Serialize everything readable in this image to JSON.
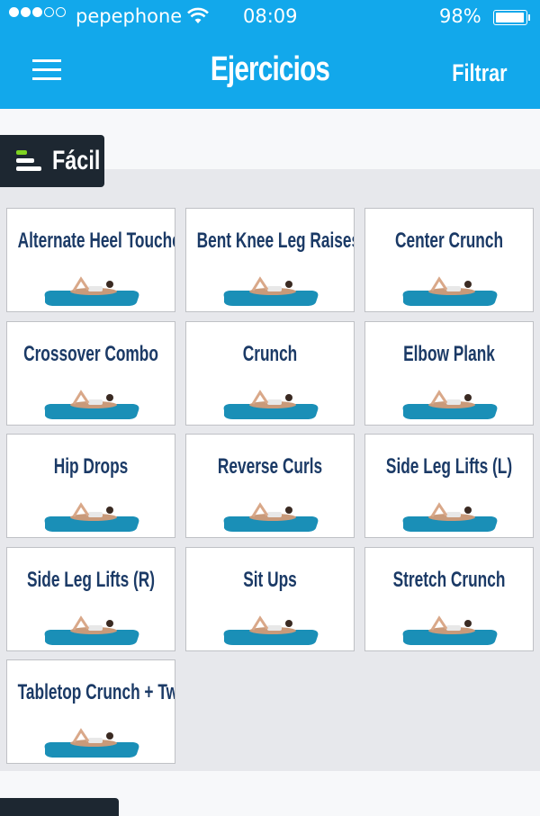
{
  "status_bar": {
    "signal_bars_filled": 3,
    "signal_bars_total": 5,
    "carrier": "pepephone",
    "wifi_icon": "wifi-icon",
    "time": "08:09",
    "battery_percent_label": "98%",
    "battery_level": 0.98
  },
  "header": {
    "menu_icon": "hamburger-menu-icon",
    "title": "Ejercicios",
    "filter_label": "Filtrar",
    "color": "#12a8eb"
  },
  "section": {
    "label": "Fácil",
    "icon": "difficulty-level-icon",
    "accent_color": "#7ed321"
  },
  "exercises": [
    {
      "name": "Alternate Heel Touchers"
    },
    {
      "name": "Bent Knee Leg Raises"
    },
    {
      "name": "Center Crunch"
    },
    {
      "name": "Crossover Combo"
    },
    {
      "name": "Crunch"
    },
    {
      "name": "Elbow Plank"
    },
    {
      "name": "Hip Drops"
    },
    {
      "name": "Reverse Curls"
    },
    {
      "name": "Side Leg Lifts (L)"
    },
    {
      "name": "Side Leg Lifts (R)"
    },
    {
      "name": "Sit Ups"
    },
    {
      "name": "Stretch Crunch"
    },
    {
      "name": "Tabletop Crunch + Twist"
    }
  ]
}
